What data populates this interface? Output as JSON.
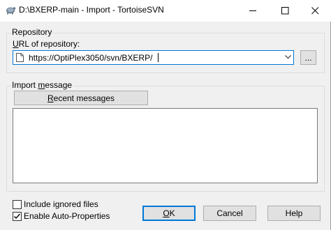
{
  "window": {
    "title": "D:\\BXERP-main - Import - TortoiseSVN",
    "controls": {
      "minimize_icon": "minimize-icon",
      "maximize_icon": "maximize-icon",
      "close_icon": "close-icon"
    }
  },
  "repository": {
    "group_label": "Repository",
    "url_label_prefix": "U",
    "url_label_rest": "RL of repository:",
    "url_value": "https://OptiPlex3050/svn/BXERP/",
    "browse_button_label": "..."
  },
  "import_message": {
    "group_label_prefix": "Import ",
    "group_label_underlined": "m",
    "group_label_rest": "essage",
    "recent_button_prefix": "",
    "recent_button_underlined": "R",
    "recent_button_rest": "ecent messages",
    "message_text": ""
  },
  "options": {
    "include_ignored": {
      "label": "Include ignored files",
      "checked": false
    },
    "auto_props": {
      "label": "Enable Auto-Properties",
      "checked": true
    }
  },
  "buttons": {
    "ok_underlined": "O",
    "ok_rest": "K",
    "cancel": "Cancel",
    "help": "Help"
  },
  "colors": {
    "accent": "#0078d7",
    "window_bg": "#f0f0f0"
  }
}
